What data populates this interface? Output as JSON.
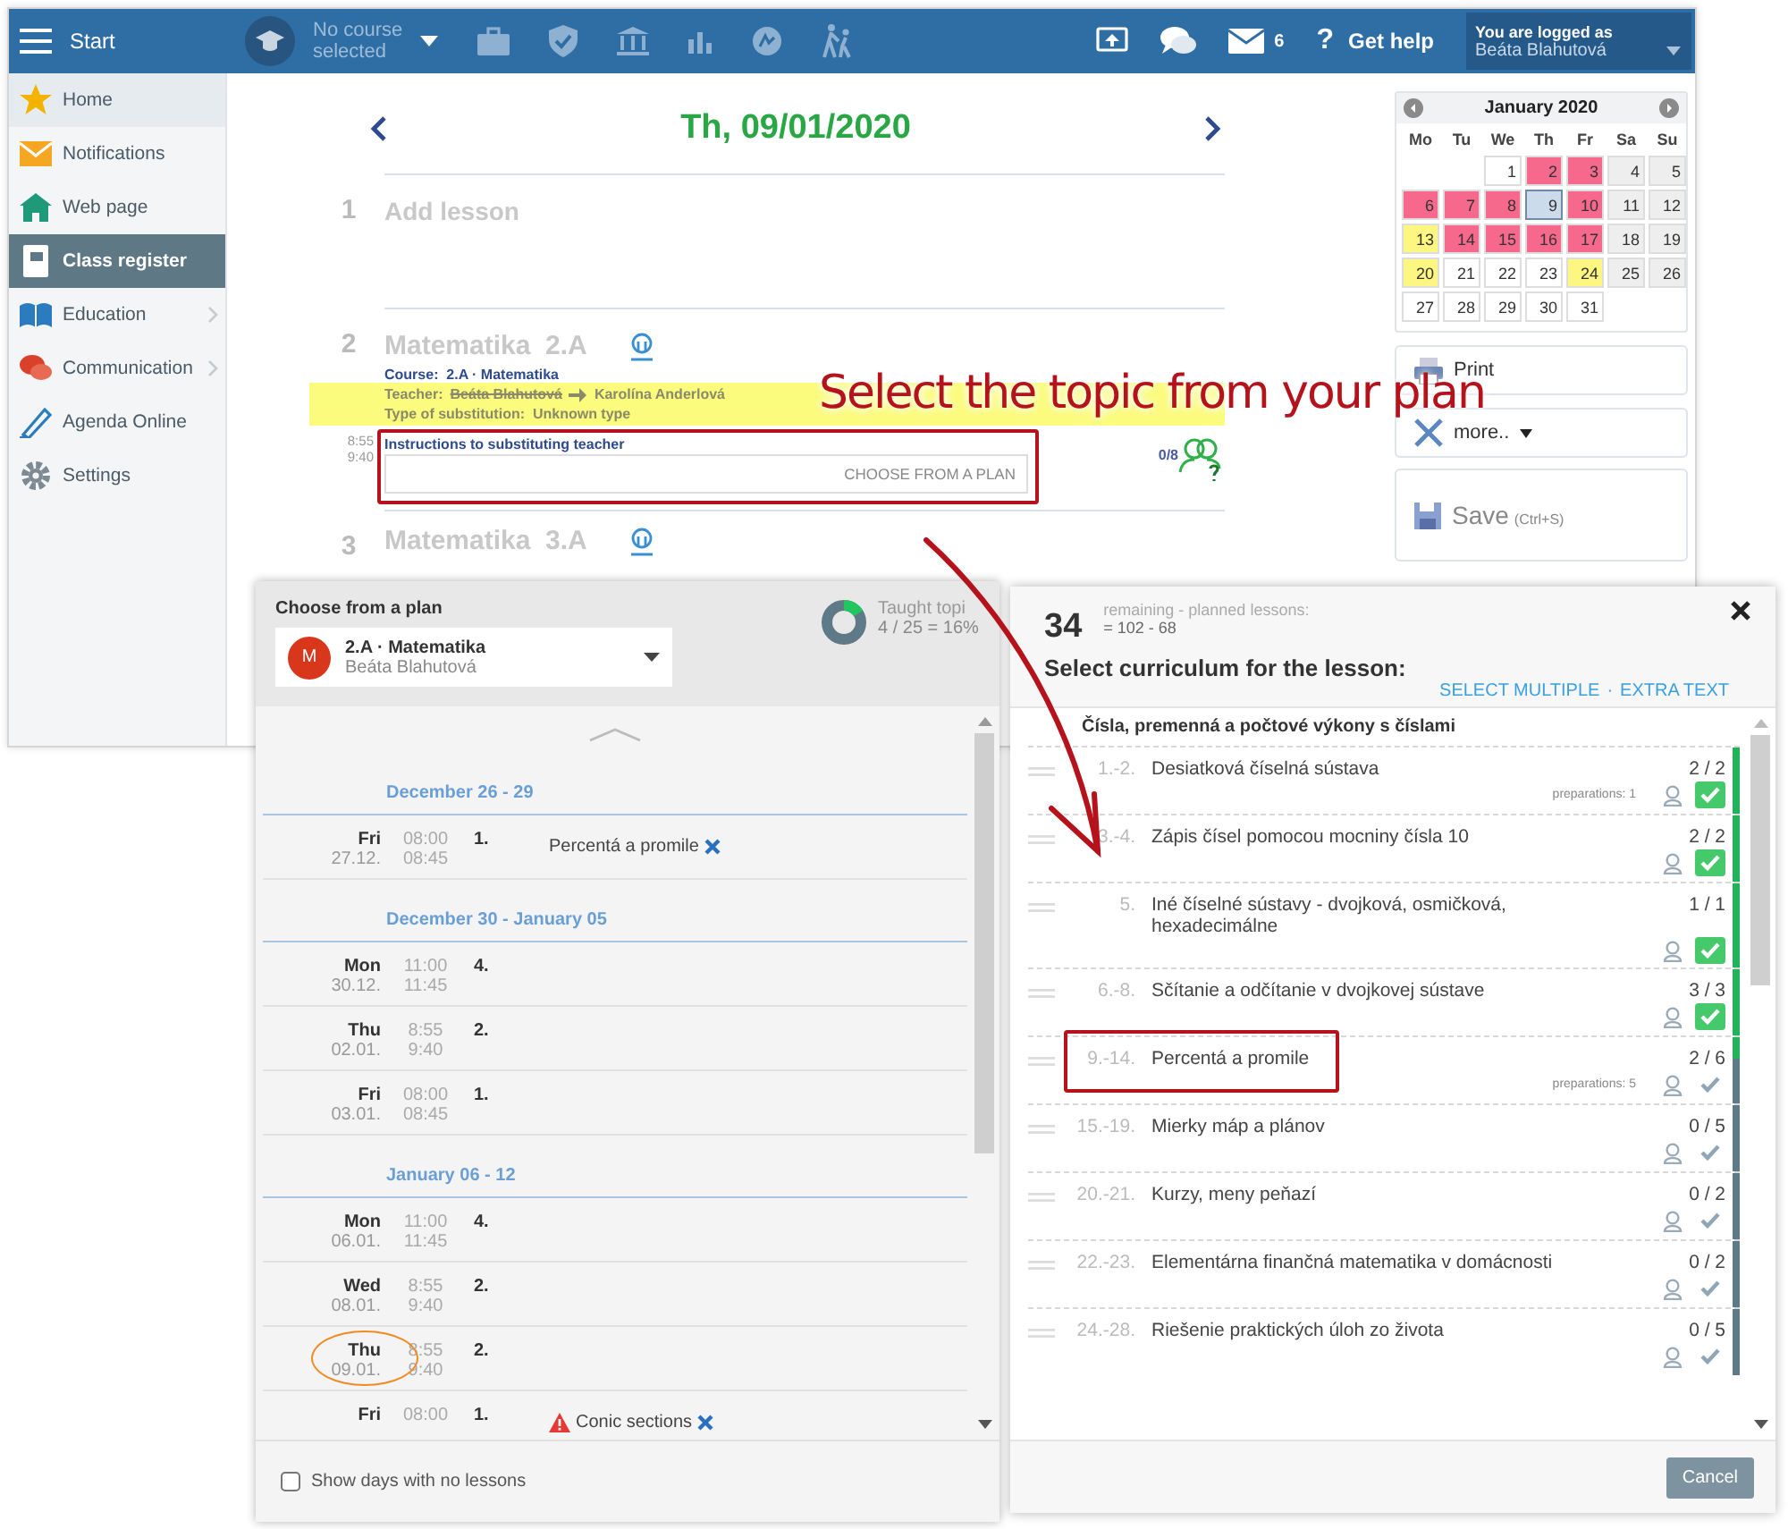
{
  "top_bar": {
    "start_label": "Start",
    "course": "No course selected",
    "mail_count": "6",
    "help_symbol": "?",
    "help_label": "Get help",
    "user_caption": "You are logged as",
    "user_name": "Beáta Blahutová"
  },
  "sidebar": {
    "items": [
      {
        "label": "Home",
        "kind": "star",
        "selected": false,
        "highlighted": true,
        "has_submenu": false
      },
      {
        "label": "Notifications",
        "kind": "envelope",
        "selected": false,
        "highlighted": false,
        "has_submenu": false
      },
      {
        "label": "Web page",
        "kind": "house",
        "selected": false,
        "highlighted": false,
        "has_submenu": false
      },
      {
        "label": "Class register",
        "kind": "notebook",
        "selected": true,
        "highlighted": false,
        "has_submenu": false
      },
      {
        "label": "Education",
        "kind": "book",
        "selected": false,
        "highlighted": false,
        "has_submenu": true
      },
      {
        "label": "Communication",
        "kind": "chat",
        "selected": false,
        "highlighted": false,
        "has_submenu": true
      },
      {
        "label": "Agenda Online",
        "kind": "pen",
        "selected": false,
        "highlighted": false,
        "has_submenu": false
      },
      {
        "label": "Settings",
        "kind": "gear",
        "selected": false,
        "highlighted": false,
        "has_submenu": false
      }
    ]
  },
  "day_view": {
    "title": "Th, 09/01/2020",
    "lessons": [
      {
        "kind": "empty",
        "number": "1",
        "title": "Add lesson"
      },
      {
        "kind": "substitution",
        "number": "2",
        "subject": "Matematika",
        "class": "2.A",
        "course_label": "Course:",
        "course": "2.A · Matematika",
        "teacher_label": "Teacher:",
        "original_teacher": "Beáta Blahutová",
        "substitute_teacher": "Karolína Anderlová",
        "substitution_label": "Type of substitution:",
        "substitution_type": "Unknown type",
        "start": "8:55",
        "end": "9:40",
        "instructions_label": "Instructions to substituting teacher",
        "placeholder": "CHOOSE FROM A PLAN",
        "highlighted": true,
        "attendance": "0/8"
      },
      {
        "kind": "lesson",
        "number": "3",
        "subject": "Matematika",
        "class": "3.A"
      }
    ]
  },
  "calendar": {
    "month": "January 2020",
    "weekdays": [
      "Mo",
      "Tu",
      "We",
      "Th",
      "Fr",
      "Sa",
      "Su"
    ],
    "days": [
      {
        "day": "1",
        "color": "#ffffff",
        "selected": false
      },
      {
        "day": "2",
        "color": "#f7698c",
        "selected": false
      },
      {
        "day": "3",
        "color": "#f7698c",
        "selected": false
      },
      {
        "day": "4",
        "color": "#eeeeee",
        "selected": false
      },
      {
        "day": "5",
        "color": "#eeeeee",
        "selected": false
      },
      {
        "day": "6",
        "color": "#f7698c",
        "selected": false
      },
      {
        "day": "7",
        "color": "#f7698c",
        "selected": false
      },
      {
        "day": "8",
        "color": "#f7698c",
        "selected": false
      },
      {
        "day": "9",
        "color": "#cbdbe9",
        "selected": true
      },
      {
        "day": "10",
        "color": "#f7698c",
        "selected": false
      },
      {
        "day": "11",
        "color": "#eeeeee",
        "selected": false
      },
      {
        "day": "12",
        "color": "#eeeeee",
        "selected": false
      },
      {
        "day": "13",
        "color": "#fdf680",
        "selected": false
      },
      {
        "day": "14",
        "color": "#f7698c",
        "selected": false
      },
      {
        "day": "15",
        "color": "#f7698c",
        "selected": false
      },
      {
        "day": "16",
        "color": "#f7698c",
        "selected": false
      },
      {
        "day": "17",
        "color": "#f7698c",
        "selected": false
      },
      {
        "day": "18",
        "color": "#eeeeee",
        "selected": false
      },
      {
        "day": "19",
        "color": "#eeeeee",
        "selected": false
      },
      {
        "day": "20",
        "color": "#fdf680",
        "selected": false
      },
      {
        "day": "21",
        "color": "#ffffff",
        "selected": false
      },
      {
        "day": "22",
        "color": "#ffffff",
        "selected": false
      },
      {
        "day": "23",
        "color": "#ffffff",
        "selected": false
      },
      {
        "day": "24",
        "color": "#fdf680",
        "selected": false
      },
      {
        "day": "25",
        "color": "#eeeeee",
        "selected": false
      },
      {
        "day": "26",
        "color": "#eeeeee",
        "selected": false
      },
      {
        "day": "27",
        "color": "#ffffff",
        "selected": false
      },
      {
        "day": "28",
        "color": "#ffffff",
        "selected": false
      },
      {
        "day": "29",
        "color": "#ffffff",
        "selected": false
      },
      {
        "day": "30",
        "color": "#ffffff",
        "selected": false
      },
      {
        "day": "31",
        "color": "#ffffff",
        "selected": false
      }
    ]
  },
  "actions": {
    "print": "Print",
    "more": "more..",
    "save": "Save",
    "save_shortcut": "(Ctrl+S)"
  },
  "plan_panel": {
    "title": "Choose from a plan",
    "avatar": "M",
    "course": "2.A · Matematika",
    "teacher": "Beáta Blahutová",
    "progress_label": "Taught topi",
    "progress_value": "4 / 25 = 16%",
    "level": 0.16,
    "weeks": [
      {
        "heading": "December 26 - 29",
        "rows": [
          {
            "day": "Fri",
            "date": "27.12.",
            "start": "08:00",
            "end": "08:45",
            "number": "1.",
            "topic": "Percentá a promile",
            "warning": false,
            "circled": false
          }
        ]
      },
      {
        "heading": "December 30 - January 05",
        "rows": [
          {
            "day": "Mon",
            "date": "30.12.",
            "start": "11:00",
            "end": "11:45",
            "number": "4.",
            "warning": false,
            "circled": false
          },
          {
            "day": "Thu",
            "date": "02.01.",
            "start": "8:55",
            "end": "9:40",
            "number": "2.",
            "warning": false,
            "circled": false
          },
          {
            "day": "Fri",
            "date": "03.01.",
            "start": "08:00",
            "end": "08:45",
            "number": "1.",
            "warning": false,
            "circled": false
          }
        ]
      },
      {
        "heading": "January 06 - 12",
        "rows": [
          {
            "day": "Mon",
            "date": "06.01.",
            "start": "11:00",
            "end": "11:45",
            "number": "4.",
            "warning": false,
            "circled": false
          },
          {
            "day": "Wed",
            "date": "08.01.",
            "start": "8:55",
            "end": "9:40",
            "number": "2.",
            "warning": false,
            "circled": false
          },
          {
            "day": "Thu",
            "date": "09.01.",
            "start": "8:55",
            "end": "9:40",
            "number": "2.",
            "warning": false,
            "circled": true
          },
          {
            "day": "Fri",
            "start": "08:00",
            "number": "1.",
            "topic": "Conic sections",
            "warning": true,
            "circled": false
          }
        ]
      }
    ],
    "show_empty_label": "Show days with no lessons",
    "show_empty_checked": false
  },
  "curriculum_panel": {
    "remaining": "34",
    "remaining_label": "remaining - planned lessons:",
    "remaining_formula": "= 102 - 68",
    "heading": "Select curriculum for the lesson:",
    "links": [
      "SELECT MULTIPLE",
      "EXTRA TEXT"
    ],
    "link_separator": "·",
    "group": "Čísla, premenná a počtové výkony s číslami",
    "items": [
      {
        "range": "1.-2.",
        "title": "Desiatková číselná sústava",
        "count": "2 / 2",
        "preparations": "preparations: 1",
        "done": true,
        "level": 1,
        "highlighted": false
      },
      {
        "range": "3.-4.",
        "title": "Zápis čísel pomocou mocniny čísla 10",
        "count": "2 / 2",
        "done": true,
        "level": 1,
        "highlighted": false
      },
      {
        "range": "5.",
        "title": "Iné číselné sústavy - dvojková, osmičková, hexadecimálne",
        "count": "1 / 1",
        "done": true,
        "level": 1,
        "highlighted": false
      },
      {
        "range": "6.-8.",
        "title": "Sčítanie a odčítanie v dvojkovej sústave",
        "count": "3 / 3",
        "done": true,
        "level": 1,
        "highlighted": false
      },
      {
        "range": "9.-14.",
        "title": "Percentá a promile",
        "count": "2 / 6",
        "preparations": "preparations: 5",
        "done": false,
        "level": 0.33,
        "highlighted": true
      },
      {
        "range": "15.-19.",
        "title": "Mierky máp a plánov",
        "count": "0 / 5",
        "done": false,
        "level": 0,
        "highlighted": false
      },
      {
        "range": "20.-21.",
        "title": "Kurzy, meny peňazí",
        "count": "0 / 2",
        "done": false,
        "level": 0,
        "highlighted": false
      },
      {
        "range": "22.-23.",
        "title": "Elementárna finančná matematika v domácnosti",
        "count": "0 / 2",
        "done": false,
        "level": 0,
        "highlighted": false
      },
      {
        "range": "24.-28.",
        "title": "Riešenie praktických úloh zo života",
        "count": "0 / 5",
        "done": false,
        "level": 0,
        "highlighted": false
      }
    ],
    "cancel": "Cancel"
  },
  "callout": "Select the topic from your plan"
}
